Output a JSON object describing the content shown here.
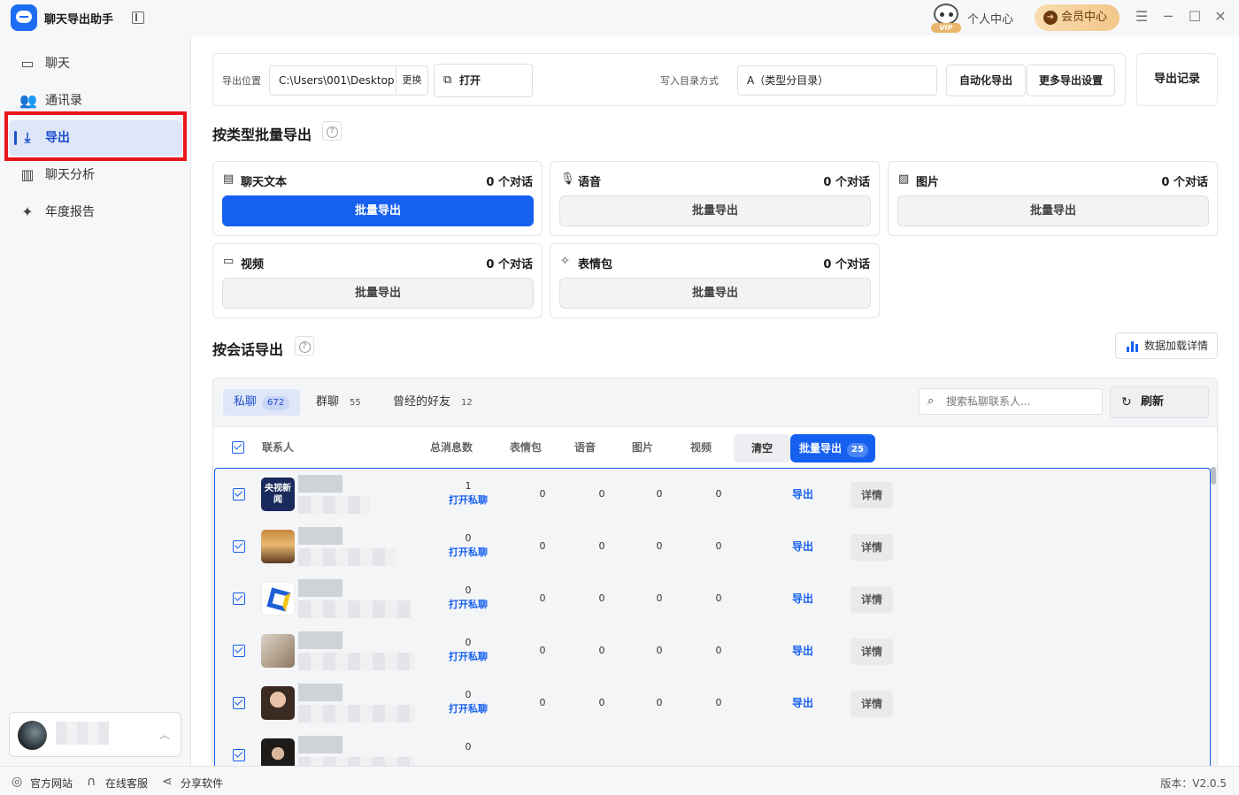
{
  "app": {
    "title": "聊天导出助手"
  },
  "header": {
    "personal_center": "个人中心",
    "member_center": "会员中心",
    "vip_badge": "VIP"
  },
  "sidebar": {
    "items": [
      {
        "label": "聊天",
        "icon": "chat-icon"
      },
      {
        "label": "通讯录",
        "icon": "contacts-icon"
      },
      {
        "label": "导出",
        "icon": "download-icon"
      },
      {
        "label": "聊天分析",
        "icon": "bar-chart-icon"
      },
      {
        "label": "年度报告",
        "icon": "sparkle-icon"
      }
    ],
    "active": "导出"
  },
  "toolbar": {
    "export_location_label": "导出位置",
    "export_path": "C:\\Users\\001\\Desktop",
    "change_label": "更换",
    "open_label": "打开",
    "dir_mode_label": "写入目录方式",
    "dir_mode_value": "A（类型分目录）",
    "auto_export_label": "自动化导出",
    "more_settings_label": "更多导出设置",
    "export_record_label": "导出记录"
  },
  "batch_by_type": {
    "title": "按类型批量导出",
    "cards": [
      {
        "name": "聊天文本",
        "count": "0 个对话",
        "button": "批量导出",
        "icon": "message-text-icon"
      },
      {
        "name": "语音",
        "count": "0 个对话",
        "button": "批量导出",
        "icon": "microphone-icon"
      },
      {
        "name": "图片",
        "count": "0 个对话",
        "button": "批量导出",
        "icon": "image-icon"
      },
      {
        "name": "视频",
        "count": "0 个对话",
        "button": "批量导出",
        "icon": "video-icon"
      },
      {
        "name": "表情包",
        "count": "0 个对话",
        "button": "批量导出",
        "icon": "magic-wand-icon"
      }
    ]
  },
  "by_conversation": {
    "title": "按会话导出",
    "data_detail_label": "数据加载详情",
    "tabs": [
      {
        "label": "私聊",
        "count": "672"
      },
      {
        "label": "群聊",
        "count": "55"
      },
      {
        "label": "曾经的好友",
        "count": "12"
      }
    ],
    "search_placeholder": "搜索私聊联系人...",
    "refresh_label": "刷新",
    "columns": [
      "联系人",
      "总消息数",
      "表情包",
      "语音",
      "图片",
      "视频"
    ],
    "clear_label": "清空",
    "batch_export_label": "批量导出",
    "batch_export_count": "25",
    "open_chat_label": "打开私聊",
    "export_label": "导出",
    "detail_label": "详情",
    "rows": [
      {
        "total": "1",
        "stickers": "0",
        "voice": "0",
        "images": "0",
        "videos": "0",
        "avatar_text": "央视新闻"
      },
      {
        "total": "0",
        "stickers": "0",
        "voice": "0",
        "images": "0",
        "videos": "0"
      },
      {
        "total": "0",
        "stickers": "0",
        "voice": "0",
        "images": "0",
        "videos": "0"
      },
      {
        "total": "0",
        "stickers": "0",
        "voice": "0",
        "images": "0",
        "videos": "0"
      },
      {
        "total": "0",
        "stickers": "0",
        "voice": "0",
        "images": "0",
        "videos": "0"
      },
      {
        "total": "0"
      }
    ]
  },
  "statusbar": {
    "website": "官方网站",
    "support": "在线客服",
    "share": "分享软件",
    "version": "版本：V2.0.5"
  }
}
